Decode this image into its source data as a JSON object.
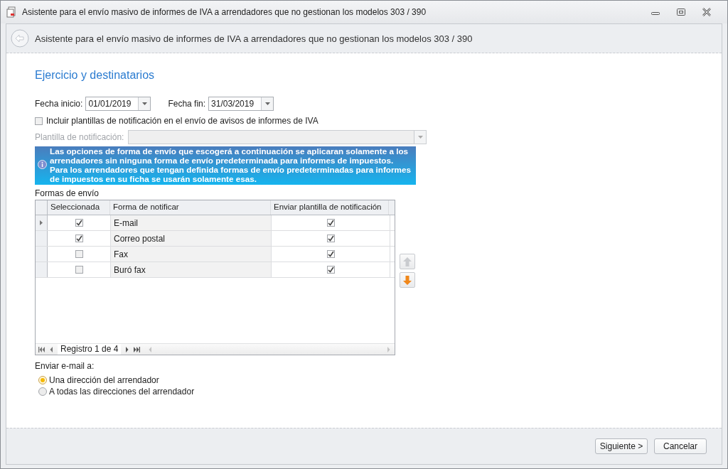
{
  "window": {
    "title": "Asistente para el envío masivo de informes de IVA a arrendadores que no gestionan los modelos 303 / 390"
  },
  "header": {
    "title": "Asistente para el envío masivo de informes de IVA a arrendadores que no gestionan los modelos 303 / 390"
  },
  "section_title": "Ejercicio y destinatarios",
  "start_date": {
    "label": "Fecha inicio:",
    "value": "01/01/2019"
  },
  "end_date": {
    "label": "Fecha fin:",
    "value": "31/03/2019"
  },
  "include_templates": {
    "label": "Incluir plantillas de notificación en el envío de avisos de informes de IVA",
    "checked": false
  },
  "template_field": {
    "label": "Plantilla de notificación:",
    "disabled": true
  },
  "info_message": "Las opciones de forma de envío que escogerá a continuación se aplicaran solamente a los arrendadores sin ninguna forma de envío predeterminada para informes de impuestos. Para los arrendadores que tengan definida formas de envío predeterminadas para informes de impuestos en su ficha se usarán solamente esas.",
  "shipping_methods": {
    "label": "Formas de envío",
    "columns": [
      "Seleccionada",
      "Forma de notificar",
      "Enviar plantilla de notificación"
    ],
    "rows": [
      {
        "current": true,
        "selected": true,
        "method": "E-mail",
        "send_template": true
      },
      {
        "current": false,
        "selected": true,
        "method": "Correo postal",
        "send_template": true
      },
      {
        "current": false,
        "selected": false,
        "method": "Fax",
        "send_template": true
      },
      {
        "current": false,
        "selected": false,
        "method": "Buró fax",
        "send_template": true
      }
    ],
    "record_text": "Registro 1 de 4"
  },
  "email_target": {
    "label": "Enviar e-mail a:",
    "options": [
      {
        "label": "Una dirección del arrendador",
        "selected": true
      },
      {
        "label": "A todas las direcciones del arrendador",
        "selected": false
      }
    ]
  },
  "buttons": [
    "Siguiente >",
    "Cancelar"
  ]
}
